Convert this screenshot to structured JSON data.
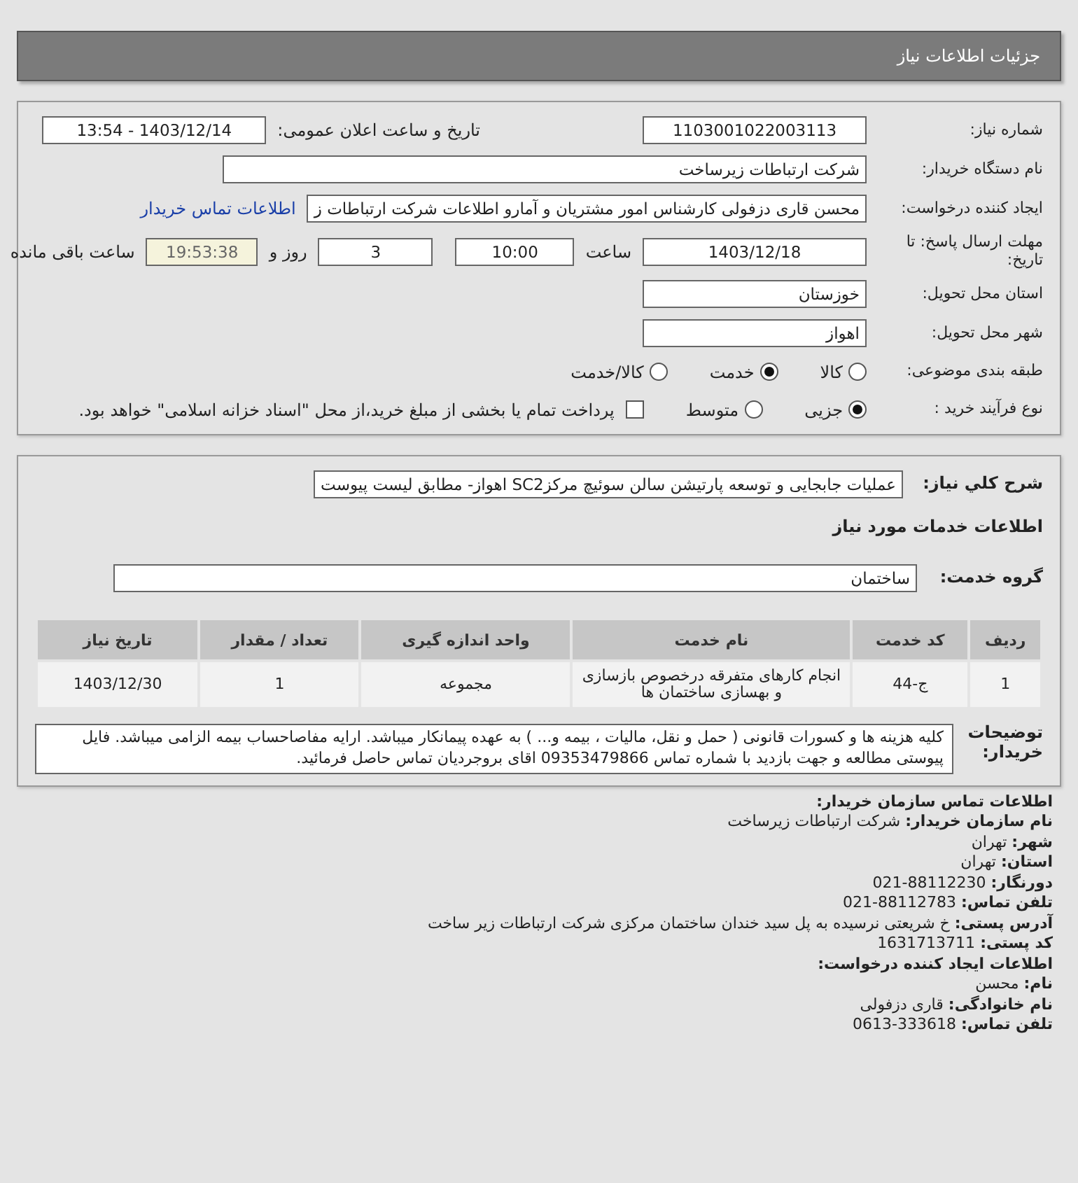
{
  "header": {
    "title": "جزئیات اطلاعات نیاز"
  },
  "need_number": {
    "label": "شماره نیاز:",
    "value": "1103001022003113"
  },
  "announce": {
    "label": "تاریخ و ساعت اعلان عمومی:",
    "value": "1403/12/14 - 13:54"
  },
  "buyer_org": {
    "label": "نام دستگاه خریدار:",
    "value": "شرکت ارتباطات زیرساخت"
  },
  "requester": {
    "label": "ایجاد کننده درخواست:",
    "value": "محسن قاری دزفولی کارشناس امور مشتریان و آمارو اطلاعات شرکت ارتباطات ز",
    "link": "اطلاعات تماس خریدار"
  },
  "deadline": {
    "label": "مهلت ارسال پاسخ: تا تاریخ:",
    "date": "1403/12/18",
    "time_label": "ساعت",
    "time": "10:00",
    "days": "3",
    "days_label": "روز و",
    "remaining": "19:53:38",
    "remaining_label": "ساعت باقی مانده"
  },
  "province": {
    "label": "استان محل تحویل:",
    "value": "خوزستان"
  },
  "city": {
    "label": "شهر محل تحویل:",
    "value": "اهواز"
  },
  "category": {
    "label": "طبقه بندی موضوعی:",
    "options": [
      {
        "label": "کالا",
        "selected": false
      },
      {
        "label": "خدمت",
        "selected": true
      },
      {
        "label": "کالا/خدمت",
        "selected": false
      }
    ]
  },
  "process": {
    "label": "نوع فرآیند خرید :",
    "options": [
      {
        "label": "جزیی",
        "selected": true
      },
      {
        "label": "متوسط",
        "selected": false
      }
    ],
    "payment": {
      "label": "پرداخت تمام یا بخشی از مبلغ خرید،از محل \"اسناد خزانه اسلامی\" خواهد بود.",
      "checked": false
    }
  },
  "summary": {
    "label": "شرح کلي نياز:",
    "value": "عملیات جابجایی و توسعه پارتیشن سالن سوئیچ مرکزSC2 اهواز- مطابق لیست پیوست"
  },
  "services_heading": "اطلاعات خدمات مورد نیاز",
  "service_group": {
    "label": "گروه خدمت:",
    "value": "ساختمان"
  },
  "table": {
    "columns": [
      "ردیف",
      "کد خدمت",
      "نام خدمت",
      "واحد اندازه گیری",
      "تعداد / مقدار",
      "تاریخ نیاز"
    ],
    "rows": [
      [
        "1",
        "ج-44",
        "انجام کارهای متفرقه درخصوص بازسازی و بهسازی ساختمان ها",
        "مجموعه",
        "1",
        "1403/12/30"
      ]
    ]
  },
  "notes": {
    "label": "توضیحات خریدار:",
    "value": "کلیه هزینه ها و کسورات قانونی ( حمل و نقل، مالیات ، بیمه و... ) به عهده پیمانکار میباشد. ارایه مفاصاحساب بیمه الزامی میباشد. فایل پیوستی مطالعه و جهت بازدید با شماره تماس 09353479866 اقای بروجردیان تماس حاصل فرمائید."
  },
  "contact": [
    {
      "label": "اطلاعات تماس سازمان خریدار:"
    },
    {
      "label": "نام سازمان خریدار:",
      "value": "شرکت ارتباطات زیرساخت"
    },
    {
      "label": "شهر:",
      "value": "تهران"
    },
    {
      "label": "استان:",
      "value": "تهران"
    },
    {
      "label": "دورنگار:",
      "value": "88112230-021"
    },
    {
      "label": "تلفن تماس:",
      "value": "88112783-021"
    },
    {
      "label": "آدرس پستی:",
      "value": "خ شریعتی نرسیده به پل سید خندان ساختمان مرکزی شرکت ارتباطات زیر ساخت"
    },
    {
      "label": "کد پستی:",
      "value": "1631713711"
    },
    {
      "label": "اطلاعات ایجاد کننده درخواست:"
    },
    {
      "label": "نام:",
      "value": "محسن"
    },
    {
      "label": "نام خانوادگی:",
      "value": "قاری دزفولی"
    },
    {
      "label": "تلفن تماس:",
      "value": "333618-0613"
    }
  ]
}
